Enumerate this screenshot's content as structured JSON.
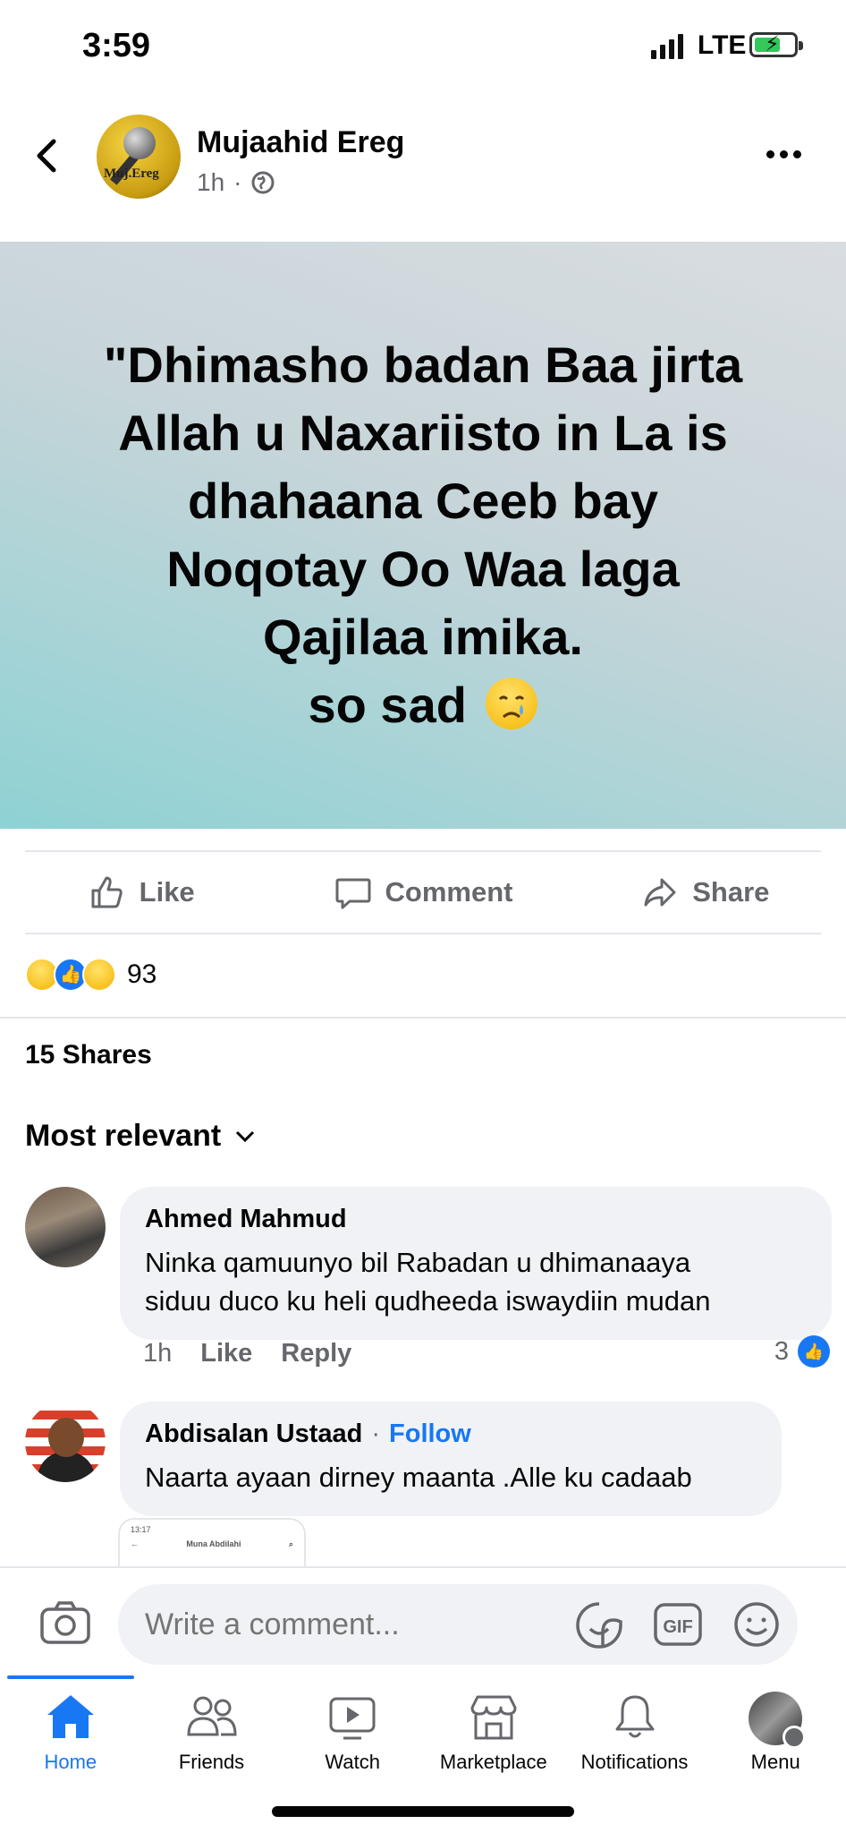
{
  "status_bar": {
    "time": "3:59",
    "network": "LTE"
  },
  "post": {
    "author": "Mujaahid Ereg",
    "avatar_text": "Muj.Ereg",
    "time": "1h",
    "separator": "·",
    "privacy_icon": "globe-icon",
    "quote": "\"Dhimasho badan Baa jirta\nAllah u Naxariisto in La is\ndhahaana Ceeb bay\nNoqotay Oo Waa laga\nQajilaa imika.\nso sad",
    "emoji": "crying-face-emoji"
  },
  "actions": {
    "like": "Like",
    "comment": "Comment",
    "share": "Share"
  },
  "reactions": {
    "icons": [
      "haha-icon",
      "like-icon",
      "sad-icon"
    ],
    "count": "93"
  },
  "shares": "15 Shares",
  "sort_label": "Most relevant",
  "comments": [
    {
      "name": "Ahmed Mahmud",
      "text": "Ninka qamuunyo bil Rabadan u dhimanaaya\nsiduu duco ku heli qudheeda iswaydiin mudan",
      "time": "1h",
      "like": "Like",
      "reply": "Reply",
      "likes": "3"
    },
    {
      "name": "Abdisalan Ustaad",
      "follow": "Follow",
      "separator": "·",
      "text": "Naarta ayaan dirney maanta .Alle ku cadaab"
    }
  ],
  "attachment_preview": {
    "time": "13:17",
    "title": "Muna Abdilahi"
  },
  "composer": {
    "placeholder": "Write a comment...",
    "icons": [
      "camera-icon",
      "sticker-icon",
      "gif-icon",
      "emoji-icon"
    ]
  },
  "nav": [
    {
      "label": "Home",
      "icon": "home-icon",
      "active": true
    },
    {
      "label": "Friends",
      "icon": "friends-icon"
    },
    {
      "label": "Watch",
      "icon": "watch-icon"
    },
    {
      "label": "Marketplace",
      "icon": "marketplace-icon"
    },
    {
      "label": "Notifications",
      "icon": "bell-icon"
    },
    {
      "label": "Menu",
      "icon": "profile-avatar"
    }
  ],
  "colors": {
    "accent": "#1877f2",
    "secondary_text": "#65676b",
    "bubble": "#f0f2f5"
  }
}
